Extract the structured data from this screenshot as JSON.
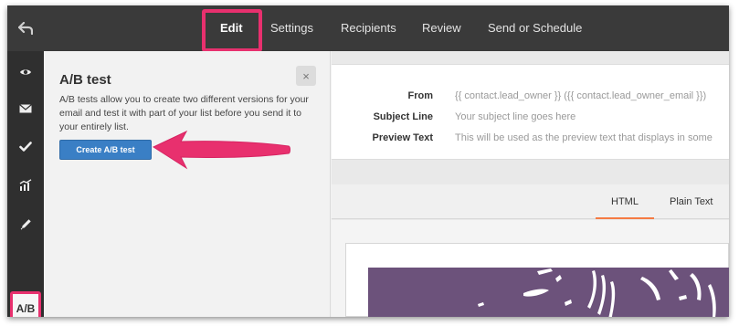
{
  "topbar": {
    "tabs": [
      {
        "label": "Edit",
        "active": true
      },
      {
        "label": "Settings"
      },
      {
        "label": "Recipients"
      },
      {
        "label": "Review"
      },
      {
        "label": "Send or Schedule"
      }
    ]
  },
  "sidebar": {
    "icons": [
      "eye-icon",
      "envelope-icon",
      "checkmark-icon",
      "chart-icon",
      "pencil-icon"
    ],
    "ab_label": "A/B"
  },
  "ab_panel": {
    "title": "A/B test",
    "description": "A/B tests allow you to create two different versions for your email and test it with part of your list before you send it to your entirely list.",
    "close_label": "×",
    "create_button": "Create A/B test"
  },
  "email_header": {
    "from_label": "From",
    "from_value": "{{ contact.lead_owner }} ({{ contact.lead_owner_email }})",
    "subject_label": "Subject Line",
    "subject_value": "Your subject line goes here",
    "preview_label": "Preview Text",
    "preview_value": "This will be used as the preview text that displays in some"
  },
  "content_tabs": [
    {
      "label": "HTML",
      "active": true
    },
    {
      "label": "Plain Text"
    }
  ],
  "colors": {
    "highlight": "#e8306e",
    "primary_button": "#3a7fc5",
    "active_tab_underline": "#f57b43",
    "hero_image": "#6c527b",
    "topbar": "#3a3a3a",
    "sidebar": "#2f2f2f"
  }
}
